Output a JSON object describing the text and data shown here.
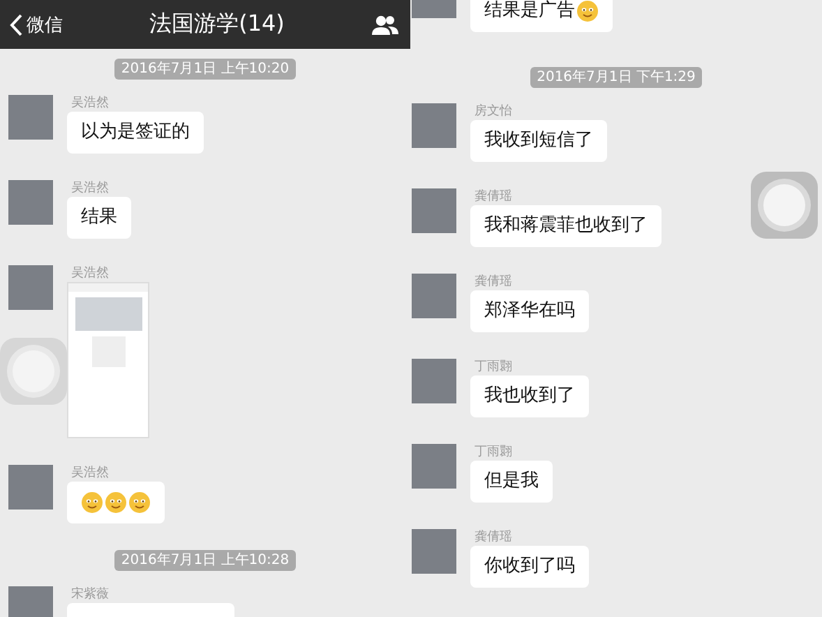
{
  "left_screen": {
    "header": {
      "back_label": "微信",
      "title": "法国游学(14)"
    },
    "items": [
      {
        "kind": "time",
        "text": "2016年7月1日 上午10:20"
      },
      {
        "kind": "text_message",
        "sender": "吴浩然",
        "parts": [
          {
            "kind": "text",
            "text": "以为是签证的"
          }
        ]
      },
      {
        "kind": "text_message",
        "sender": "吴浩然",
        "parts": [
          {
            "kind": "text",
            "text": "结果"
          }
        ]
      },
      {
        "kind": "image_message",
        "sender": "吴浩然"
      },
      {
        "kind": "text_message",
        "sender": "吴浩然",
        "parts": [
          {
            "kind": "emoji"
          },
          {
            "kind": "emoji"
          },
          {
            "kind": "emoji"
          }
        ]
      },
      {
        "kind": "time",
        "text": "2016年7月1日 上午10:28"
      },
      {
        "kind": "clipped_message",
        "sender": "宋紫薇"
      }
    ]
  },
  "right_screen": {
    "items": [
      {
        "kind": "text_message",
        "parts": [
          {
            "kind": "text",
            "text": "结果是广告"
          },
          {
            "kind": "emoji"
          }
        ]
      },
      {
        "kind": "time",
        "text": "2016年7月1日 下午1:29"
      },
      {
        "kind": "text_message",
        "sender": "房文怡",
        "parts": [
          {
            "kind": "text",
            "text": "我收到短信了"
          }
        ]
      },
      {
        "kind": "text_message",
        "sender": "龚倩瑶",
        "parts": [
          {
            "kind": "text",
            "text": "我和蒋震菲也收到了"
          }
        ]
      },
      {
        "kind": "text_message",
        "sender": "龚倩瑶",
        "parts": [
          {
            "kind": "text",
            "text": "郑泽华在吗"
          }
        ]
      },
      {
        "kind": "text_message",
        "sender": "丁雨翾",
        "parts": [
          {
            "kind": "text",
            "text": "我也收到了"
          }
        ]
      },
      {
        "kind": "text_message",
        "sender": "丁雨翾",
        "parts": [
          {
            "kind": "text",
            "text": "但是我"
          }
        ]
      },
      {
        "kind": "text_message",
        "sender": "龚倩瑶",
        "parts": [
          {
            "kind": "text",
            "text": "你收到了吗"
          }
        ]
      }
    ]
  }
}
